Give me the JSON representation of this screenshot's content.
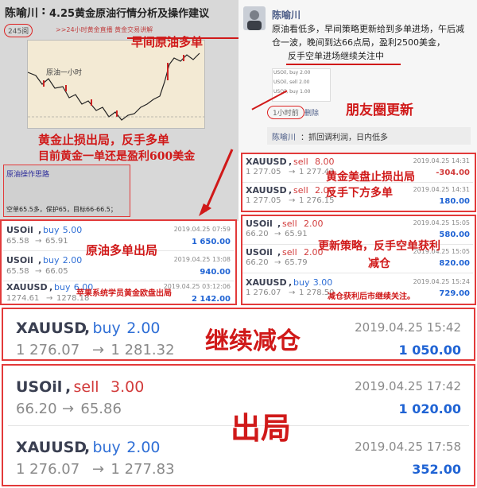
{
  "top_left": {
    "author": "陈喻川",
    "title": "4.25黄金原油行情分析及操作建议",
    "views": "245阅",
    "chart_caption": ">>24小时黄金直播 黄金交易讲解",
    "chart_label": "原油一小时",
    "anno_oil_long": "早间原油多单",
    "anno_gold_1": "黄金止损出局，反手多单",
    "anno_gold_2": "目前黄金一单还是盈利600美金",
    "box_title": "原油操作思路",
    "box_text": "空单65.5多，保护65，目标66-66.5；"
  },
  "top_right": {
    "name": "陈喻川",
    "post_text": "原油看低多，早间策略更新给到多单进场，午后减仓一波，晚间到达66点局，盈利2500美金，",
    "post_highlight": "反手空单进场继续关注中",
    "time": "1小时前",
    "delete": "删除",
    "moments_label": "朋友圈更新",
    "comment_name": "陈喻川",
    "comment_text": "：抓回调利润，日内低多"
  },
  "left_trades": [
    {
      "symbol": "USOil",
      "side": "buy",
      "lots": "5.00",
      "date": "2019.04.25 07:59",
      "open": "65.58",
      "close": "65.91",
      "pl": "1 650.00"
    },
    {
      "symbol": "USOil",
      "side": "buy",
      "lots": "2.00",
      "date": "2019.04.25 13:08",
      "open": "65.58",
      "close": "66.05",
      "pl": "940.00"
    },
    {
      "symbol": "XAUUSD",
      "side": "buy",
      "lots": "6.00",
      "date": "2019.04.25 03:12:06",
      "open": "1274.61",
      "close": "1278.18",
      "pl": "2 142.00"
    }
  ],
  "right_trades": [
    {
      "symbol": "XAUUSD",
      "side": "sell",
      "lots": "8.00",
      "date": "2019.04.25 14:31",
      "open": "1 277.05",
      "close": "1 277.43",
      "pl": "-304.00"
    },
    {
      "symbol": "XAUUSD",
      "side": "sell",
      "lots": "2.00",
      "date": "2019.04.25 14:31",
      "open": "1 277.05",
      "close": "1 276.15",
      "pl": "180.00"
    },
    {
      "symbol": "USOil",
      "side": "sell",
      "lots": "2.00",
      "date": "2019.04.25 15:05",
      "open": "66.20",
      "close": "65.91",
      "pl": "580.00"
    },
    {
      "symbol": "USOil",
      "side": "sell",
      "lots": "2.00",
      "date": "2019.04.25 15:05",
      "open": "66.20",
      "close": "65.79",
      "pl": "820.00"
    },
    {
      "symbol": "XAUUSD",
      "side": "buy",
      "lots": "3.00",
      "date": "2019.04.25 15:24",
      "open": "1 276.07",
      "close": "1 278.50",
      "pl": "729.00"
    }
  ],
  "annotations": {
    "left_oil_exit": "原油多单出局",
    "left_member": "苹果系统学员黄金欧盘出局",
    "right_gold": "黄金美盘止损出局\n反手下方多单",
    "right_strategy": "更新策略，反手空单获利\n减仓",
    "right_bottom": "减仓获利后市继续关注。",
    "mid_big": "继续减仓",
    "bottom_big": "出局"
  },
  "big_trades": [
    {
      "symbol": "XAUUSD",
      "side": "buy",
      "lots": "2.00",
      "date": "2019.04.25 15:42",
      "open": "1 276.07",
      "close": "1 281.32",
      "pl": "1 050.00"
    },
    {
      "symbol": "USOil",
      "side": "sell",
      "lots": "3.00",
      "date": "2019.04.25 17:42",
      "open": "66.20",
      "close": "65.86",
      "pl": "1 020.00"
    },
    {
      "symbol": "XAUUSD",
      "side": "buy",
      "lots": "2.00",
      "date": "2019.04.25 17:58",
      "open": "1 276.07",
      "close": "1 277.83",
      "pl": "352.00"
    }
  ],
  "arrow": "→",
  "colors": {
    "accent_red": "#e23a3a",
    "buy_blue": "#2f6fd6",
    "sell_red": "#d23b3b",
    "profit_blue": "#1f63d4"
  }
}
